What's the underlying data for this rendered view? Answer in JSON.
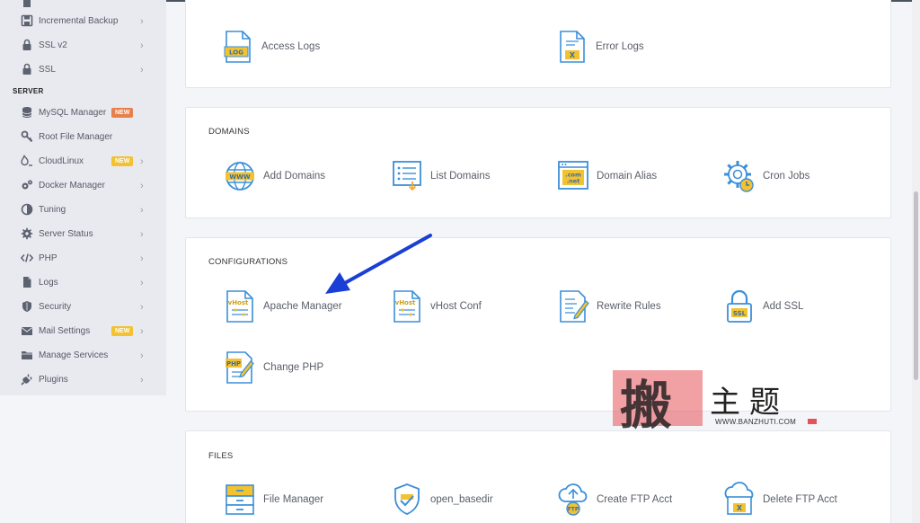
{
  "sidebar": {
    "section_header": "SERVER",
    "items": [
      {
        "label": "Incremental Backup",
        "icon": "backup-icon"
      },
      {
        "label": "SSL v2",
        "icon": "lock-icon"
      },
      {
        "label": "SSL",
        "icon": "lock-icon"
      },
      {
        "label": "MySQL Manager",
        "icon": "database-icon",
        "badge": "NEW"
      },
      {
        "label": "Root File Manager",
        "icon": "key-icon"
      },
      {
        "label": "CloudLinux",
        "icon": "cloudlinux-icon",
        "badge": "NEW"
      },
      {
        "label": "Docker Manager",
        "icon": "gears-icon"
      },
      {
        "label": "Tuning",
        "icon": "tuning-icon"
      },
      {
        "label": "Server Status",
        "icon": "gear-icon"
      },
      {
        "label": "PHP",
        "icon": "code-icon"
      },
      {
        "label": "Logs",
        "icon": "file-icon"
      },
      {
        "label": "Security",
        "icon": "shield-icon"
      },
      {
        "label": "Mail Settings",
        "icon": "envelope-icon",
        "badge": "NEW"
      },
      {
        "label": "Manage Services",
        "icon": "folder-icon"
      },
      {
        "label": "Plugins",
        "icon": "plug-icon"
      }
    ],
    "chevron": "›"
  },
  "logs_card": {
    "tiles": [
      {
        "label": "Access Logs",
        "icon": "log-file-icon"
      },
      {
        "label": "Error Logs",
        "icon": "error-file-icon"
      }
    ]
  },
  "domains_card": {
    "title": "DOMAINS",
    "tiles": [
      {
        "label": "Add Domains",
        "icon": "www-globe-icon"
      },
      {
        "label": "List Domains",
        "icon": "list-icon"
      },
      {
        "label": "Domain Alias",
        "icon": "com-net-icon"
      },
      {
        "label": "Cron Jobs",
        "icon": "gear-clock-icon"
      }
    ]
  },
  "config_card": {
    "title": "CONFIGURATIONS",
    "tiles": [
      {
        "label": "Apache Manager",
        "icon": "vhost-file-icon"
      },
      {
        "label": "vHost Conf",
        "icon": "vhost-file-icon"
      },
      {
        "label": "Rewrite Rules",
        "icon": "edit-file-icon"
      },
      {
        "label": "Add SSL",
        "icon": "ssl-lock-icon"
      },
      {
        "label": "Change PHP",
        "icon": "php-file-icon"
      }
    ]
  },
  "files_card": {
    "title": "FILES",
    "tiles": [
      {
        "label": "File Manager",
        "icon": "file-cabinet-icon"
      },
      {
        "label": "open_basedir",
        "icon": "shield-check-icon"
      },
      {
        "label": "Create FTP Acct",
        "icon": "ftp-cloud-icon"
      },
      {
        "label": "Delete FTP Acct",
        "icon": "ftp-delete-icon"
      }
    ]
  },
  "watermark": {
    "big_char": "搬",
    "small_chars": "主题",
    "url": "WWW.BANZHUTI.COM"
  },
  "colors": {
    "sidebar_bg": "#e9e9f0",
    "icon_blue": "#3b8fd9",
    "icon_yellow": "#f2c230",
    "arrow_blue": "#1a3fd6",
    "badge_orange": "#e8804a"
  }
}
